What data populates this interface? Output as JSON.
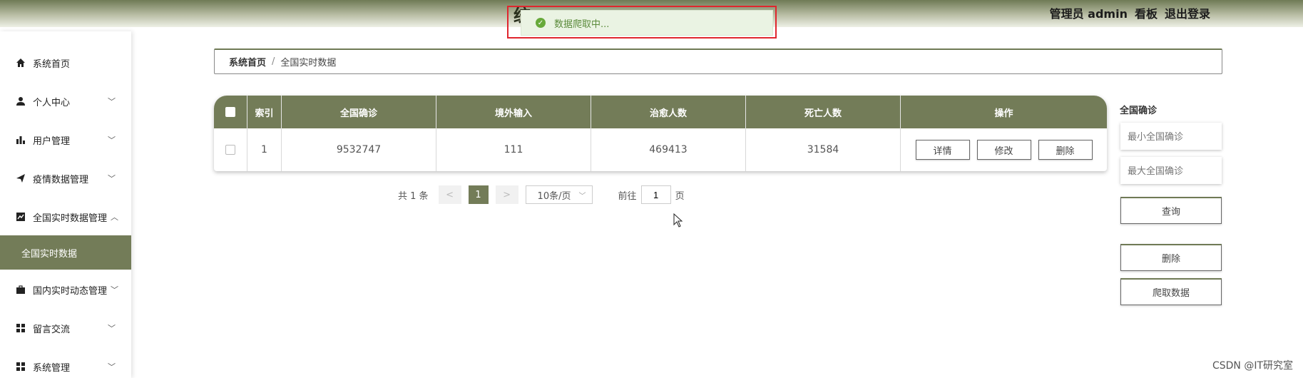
{
  "header": {
    "title": "统",
    "user": "管理员 admin",
    "dashboard": "看板",
    "logout": "退出登录"
  },
  "toast": {
    "message": "数据爬取中..."
  },
  "sidebar": {
    "items": [
      {
        "label": "系统首页",
        "icon": "home-icon"
      },
      {
        "label": "个人中心",
        "icon": "user-icon"
      },
      {
        "label": "用户管理",
        "icon": "bar-chart-icon"
      },
      {
        "label": "疫情数据管理",
        "icon": "send-icon"
      },
      {
        "label": "全国实时数据管理",
        "icon": "trend-icon"
      },
      {
        "label": "全国实时数据",
        "icon": ""
      },
      {
        "label": "国内实时动态管理",
        "icon": "briefcase-icon"
      },
      {
        "label": "留言交流",
        "icon": "grid-icon"
      },
      {
        "label": "系统管理",
        "icon": "grid-icon"
      }
    ]
  },
  "breadcrumb": {
    "home": "系统首页",
    "separator": "/",
    "current": "全国实时数据"
  },
  "table": {
    "headers": [
      "索引",
      "全国确诊",
      "境外输入",
      "治愈人数",
      "死亡人数",
      "操作"
    ],
    "rows": [
      {
        "index": "1",
        "confirmed": "9532747",
        "imported": "111",
        "cured": "469413",
        "deaths": "31584"
      }
    ],
    "actions": {
      "detail": "详情",
      "edit": "修改",
      "delete": "删除"
    }
  },
  "pagination": {
    "total": "共 1 条",
    "prev": "<",
    "current": "1",
    "next": ">",
    "page_size": "10条/页",
    "goto_prefix": "前往",
    "goto_value": "1",
    "goto_suffix": "页"
  },
  "search": {
    "label": "全国确诊",
    "min_placeholder": "最小全国确诊",
    "max_placeholder": "最大全国确诊",
    "query": "查询",
    "delete": "删除",
    "crawl": "爬取数据"
  },
  "watermark": "CSDN @IT研究室",
  "colors": {
    "accent": "#737c58",
    "highlight": "#e0262e",
    "success": "#67a93a"
  }
}
